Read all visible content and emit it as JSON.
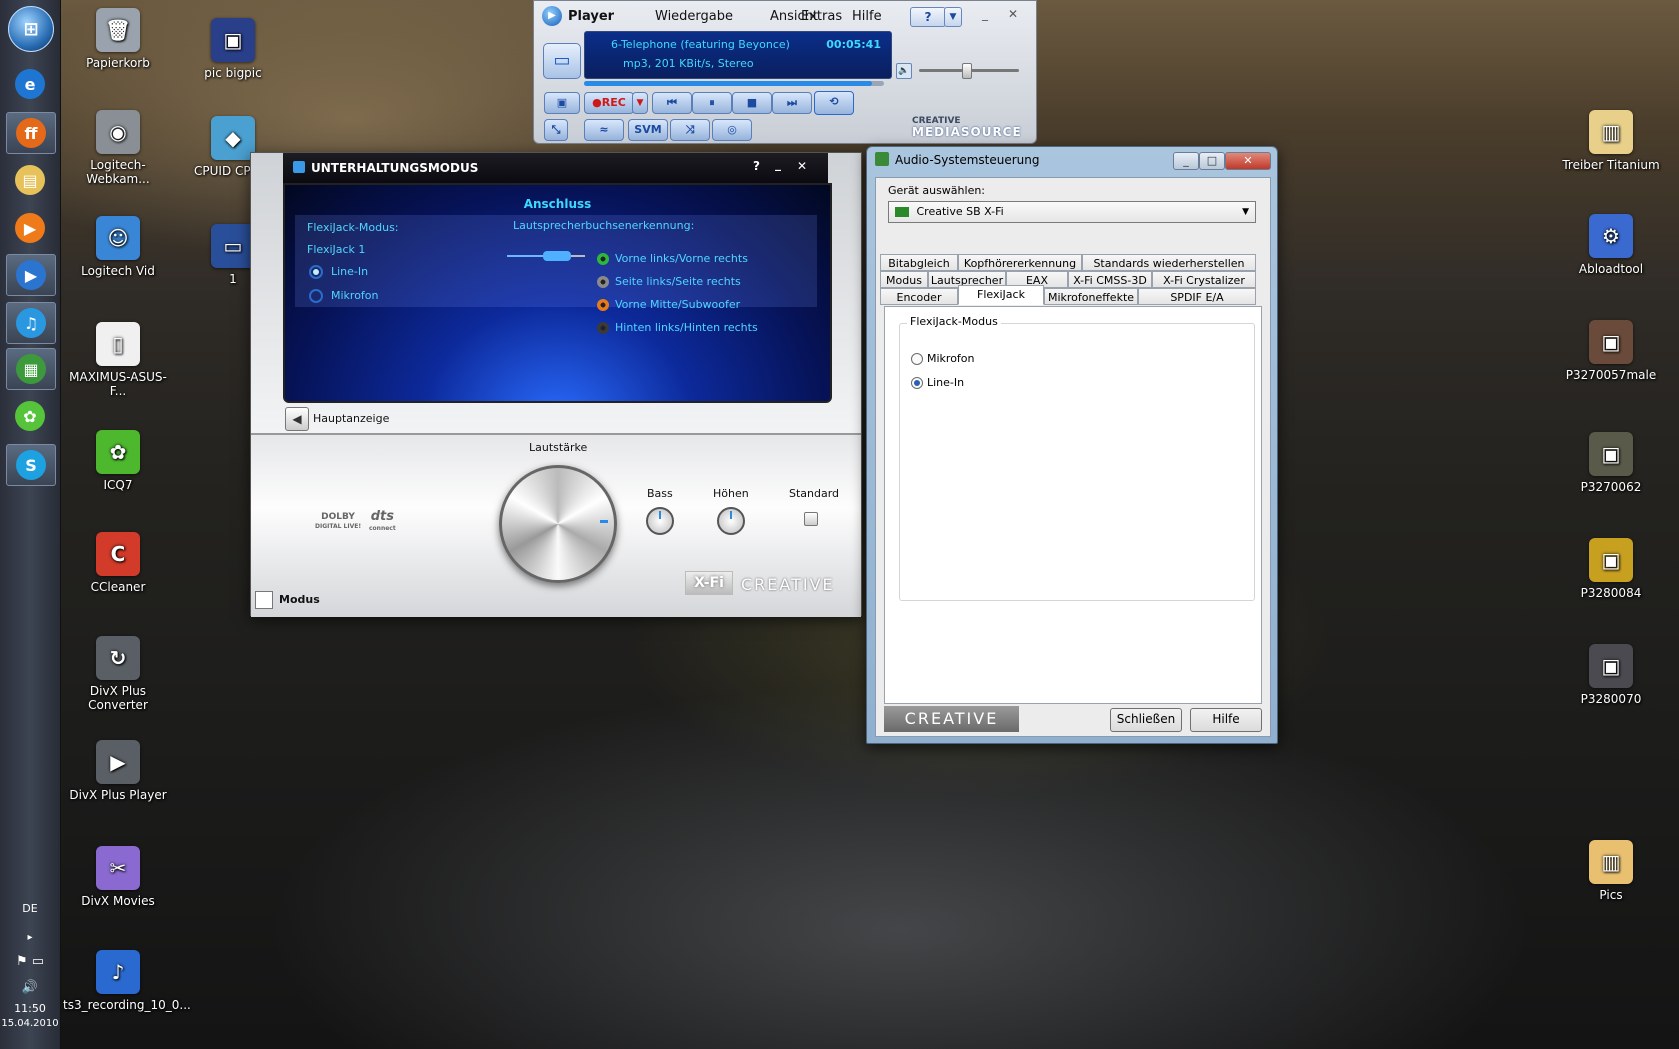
{
  "taskbar": {
    "items": [
      {
        "icon": "internet-explorer-icon",
        "glyph": "e",
        "color": "#1f76d2"
      },
      {
        "icon": "firefox-icon",
        "glyph": "ff",
        "color": "#e46a1a",
        "active": true
      },
      {
        "icon": "folder-icon",
        "glyph": "▤",
        "color": "#e7c25a"
      },
      {
        "icon": "media-player-icon",
        "glyph": "▶",
        "color": "#ee7a1a"
      },
      {
        "icon": "mediasource-player-icon",
        "glyph": "▶",
        "color": "#2b74d0",
        "active": true
      },
      {
        "icon": "music-icon",
        "glyph": "♫",
        "color": "#2a98e0",
        "active": true
      },
      {
        "icon": "cpu-icon",
        "glyph": "▦",
        "color": "#3c9a3c",
        "active": true
      },
      {
        "icon": "icq-icon",
        "glyph": "✿",
        "color": "#55c43a"
      },
      {
        "icon": "skype-icon",
        "glyph": "S",
        "color": "#1ea1e0",
        "active": true
      }
    ],
    "language": "DE",
    "time": "11:50",
    "date": "15.04.2010"
  },
  "desktop_icons": [
    {
      "label": "Papierkorb",
      "icon": "recycle-bin-icon",
      "glyph": "🗑",
      "color": "#9aa3ad"
    },
    {
      "label": "pic bigpic",
      "icon": "picture-icon",
      "glyph": "▣",
      "color": "#2a3f8a"
    },
    {
      "label": "Logitech-Webkam...",
      "icon": "webcam-icon",
      "glyph": "◉",
      "color": "#8a8f96"
    },
    {
      "label": "CPUID CPU-Z",
      "icon": "cpuid-icon",
      "glyph": "◆",
      "color": "#4aa0d0"
    },
    {
      "label": "Logitech Vid",
      "icon": "logitech-vid-icon",
      "glyph": "☺",
      "color": "#3a86d6"
    },
    {
      "label": "1",
      "icon": "shortcut-icon",
      "glyph": "▭",
      "color": "#2a4f9a"
    },
    {
      "label": "MAXIMUS-ASUS-F...",
      "icon": "file-icon",
      "glyph": "▯",
      "color": "#f0f0f0"
    },
    {
      "label": "ICQ7",
      "icon": "icq-icon",
      "glyph": "✿",
      "color": "#4db82e"
    },
    {
      "label": "CCleaner",
      "icon": "ccleaner-icon",
      "glyph": "C",
      "color": "#d23a2a"
    },
    {
      "label": "DivX Plus Converter",
      "icon": "divx-converter-icon",
      "glyph": "↻",
      "color": "#5a5f66"
    },
    {
      "label": "DivX Plus Player",
      "icon": "divx-player-icon",
      "glyph": "▶",
      "color": "#5a5f66"
    },
    {
      "label": "DivX Movies",
      "icon": "divx-movies-icon",
      "glyph": "✂",
      "color": "#8a6ad0"
    },
    {
      "label": "ts3_recording_10_0...",
      "icon": "wav-file-icon",
      "glyph": "♪",
      "color": "#2a6ad0"
    },
    {
      "label": "Treiber Titanium",
      "icon": "folder-icon",
      "glyph": "▥",
      "color": "#e8d08a"
    },
    {
      "label": "Abloadtool",
      "icon": "abloadtool-icon",
      "glyph": "⚙",
      "color": "#3a6ad0"
    },
    {
      "label": "P3270057male",
      "icon": "photo-icon",
      "glyph": "▣",
      "color": "#6a4a3a"
    },
    {
      "label": "P3270062",
      "icon": "photo-icon",
      "glyph": "▣",
      "color": "#5a5a4a"
    },
    {
      "label": "P3280084",
      "icon": "photo-icon",
      "glyph": "▣",
      "color": "#c8a020"
    },
    {
      "label": "P3280070",
      "icon": "photo-icon",
      "glyph": "▣",
      "color": "#4a4a50"
    },
    {
      "label": "Pics",
      "icon": "folder-icon",
      "glyph": "▥",
      "color": "#e8c070"
    }
  ],
  "player": {
    "title": "Player",
    "menu": [
      "Wiedergabe",
      "Ansicht",
      "Extras",
      "Hilfe"
    ],
    "help": "?",
    "track": "6-Telephone (featuring Beyonce)",
    "time": "00:05:41",
    "info": "mp3, 201 KBit/s, Stereo",
    "progress": 0.96,
    "volume": 0.47,
    "rec": "●REC",
    "svm": "SVM",
    "brand_top": "CREATIVE",
    "brand_bottom": "MEDIASOURCE"
  },
  "entertainment": {
    "title": "UNTERHALTUNGSMODUS",
    "help": "?",
    "heading": "Anschluss",
    "flexijack_label": "FlexiJack-Modus:",
    "flexijack_port": "FlexiJack 1",
    "option_linein": "Line-In",
    "option_mic": "Mikrofon",
    "speaker_detect": "Lautsprecherbuchsenerkennung:",
    "jacks": [
      {
        "label": "Vorne links/Vorne rechts",
        "color": "#2cb83c"
      },
      {
        "label": "Seite links/Seite rechts",
        "color": "#8a8a8a"
      },
      {
        "label": "Vorne Mitte/Subwoofer",
        "color": "#e87a1a"
      },
      {
        "label": "Hinten links/Hinten rechts",
        "color": "#3a3a3a"
      }
    ],
    "back": "Hauptanzeige",
    "volume_label": "Lautstärke",
    "bass_label": "Bass",
    "treble_label": "Höhen",
    "standard_label": "Standard",
    "dolby": "DOLBY",
    "dolby_sub": "DIGITAL LIVE!",
    "dts": "dts",
    "dts_sub": "connect",
    "xfi": "X-Fi",
    "creative": "CREATIVE",
    "mode": "Modus"
  },
  "audio_control": {
    "title": "Audio-Systemsteuerung",
    "device_label": "Gerät auswählen:",
    "device": "Creative SB X-Fi",
    "tabs_row1": [
      "Bitabgleich",
      "Kopfhörererkennung",
      "Standards wiederherstellen"
    ],
    "tabs_row2": [
      "Modus",
      "Lautsprecher",
      "EAX Effekte",
      "X-Fi CMSS-3D",
      "X-Fi Crystalizer"
    ],
    "tabs_row3": [
      "Encoder",
      "FlexiJack",
      "Mikrofoneffekte",
      "SPDIF E/A"
    ],
    "group_title": "FlexiJack-Modus",
    "option_mic": "Mikrofon",
    "option_linein": "Line-In",
    "brand": "CREATIVE",
    "close": "Schließen",
    "help": "Hilfe"
  }
}
